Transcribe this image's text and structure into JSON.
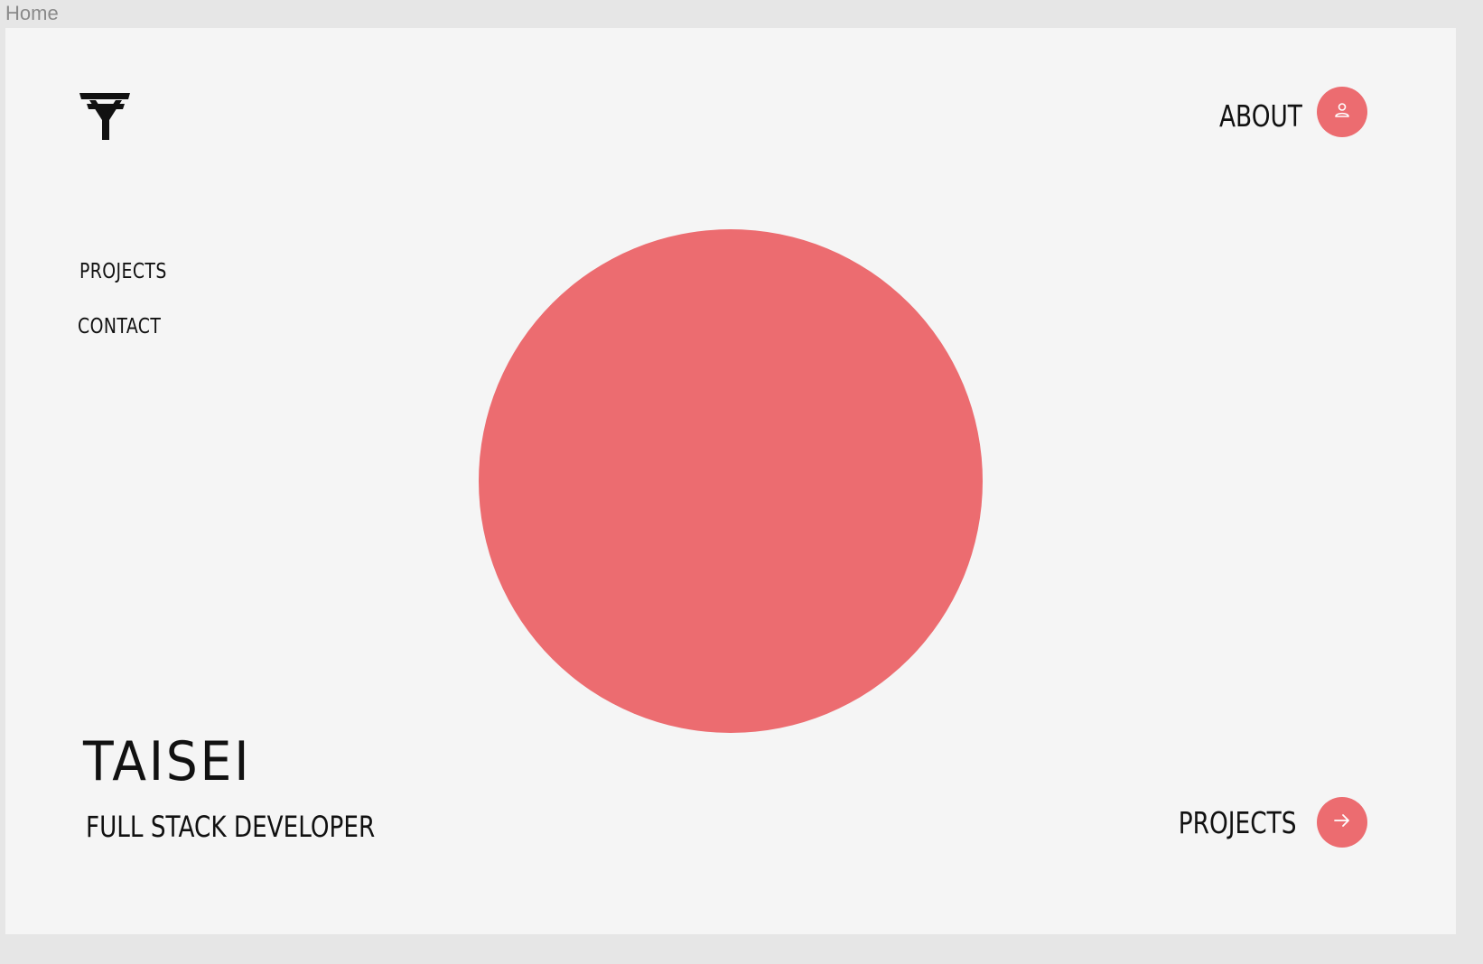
{
  "canvas": {
    "frame_label": "Home"
  },
  "colors": {
    "accent": "#ec6c70",
    "background": "#f5f5f5",
    "canvas": "#e6e6e6",
    "text": "#111111"
  },
  "logo": {
    "icon": "t-monogram-logo-icon"
  },
  "nav": {
    "items": [
      {
        "label": "PROJECTS"
      },
      {
        "label": "CONTACT"
      }
    ]
  },
  "about": {
    "label": "ABOUT",
    "icon": "user-icon"
  },
  "hero": {
    "name": "TAISEI",
    "subtitle": "FULL STACK DEVELOPER"
  },
  "footer_cta": {
    "label": "PROJECTS",
    "icon": "arrow-right-icon"
  }
}
